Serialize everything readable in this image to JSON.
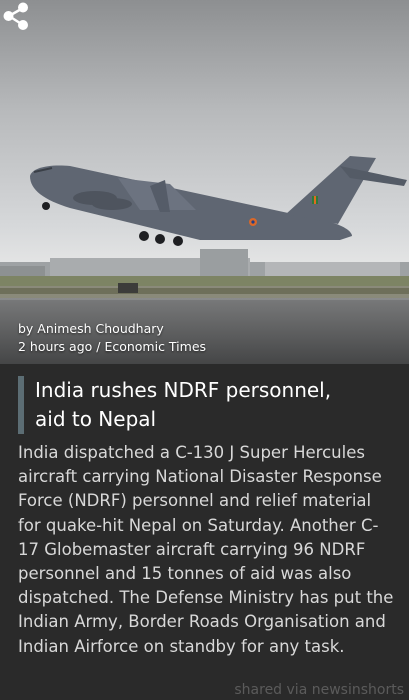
{
  "article": {
    "author": "by Animesh Choudhary",
    "time_source": "2 hours ago / Economic Times",
    "headline_line1": "India rushes NDRF personnel,",
    "headline_line2": "aid to Nepal",
    "body": "India dispatched a C-130 J Super Hercules aircraft carrying National Disaster Response Force (NDRF) personnel and relief material for quake-hit Nepal on Saturday. Another C-17 Globemaster aircraft carrying 96 NDRF personnel and 15 tonnes of aid was also dispatched. The Defense Ministry has put the Indian Army, Border Roads Organisation and Indian Airforce on standby for any task."
  },
  "footer": {
    "text": "shared via newsinshorts"
  },
  "icons": {
    "share": "share-icon"
  },
  "colors": {
    "background": "#2a2a2a",
    "headline_bar": "#5c6d74"
  }
}
